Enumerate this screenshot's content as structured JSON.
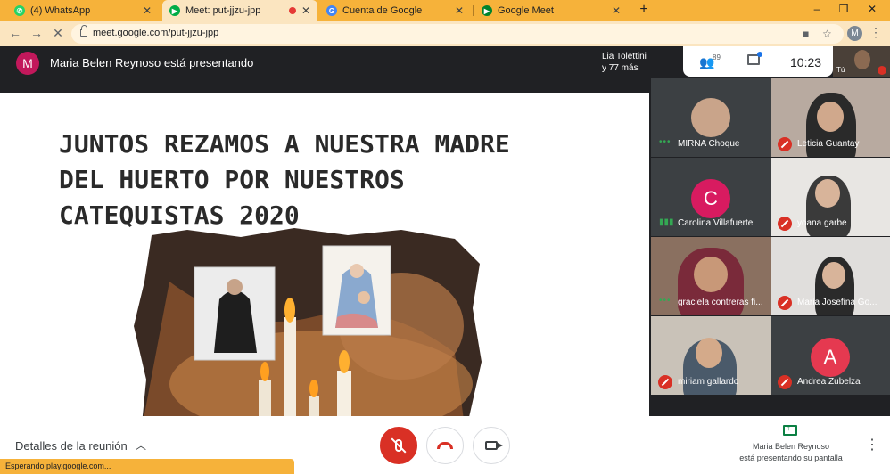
{
  "browser": {
    "tabs": [
      {
        "title": "(4) WhatsApp",
        "favicon": "whatsapp-icon",
        "color": "#25d366"
      },
      {
        "title": "Meet: put-jjzu-jpp",
        "favicon": "meet-icon",
        "color": "#00ac47",
        "active": true,
        "recording": true
      },
      {
        "title": "Cuenta de Google",
        "favicon": "google-icon",
        "color": "#4285f4"
      },
      {
        "title": "Google Meet",
        "favicon": "meet-icon",
        "color": "#00832d"
      }
    ],
    "url": "meet.google.com/put-jjzu-jpp",
    "profile_initial": "M",
    "status_text": "Esperando play.google.com..."
  },
  "meet_header": {
    "presenter_initial": "M",
    "presenter_text": "Maria Belen Reynoso está presentando",
    "pinned_line1": "Lia Tolettini",
    "pinned_line2": "y 77 más",
    "participants_count": "89",
    "time": "10:23",
    "self_label": "Tú"
  },
  "slide": {
    "title": "JUNTOS REZAMOS A NUESTRA MADRE DEL HUERTO POR NUESTROS CATEQUISTAS 2020"
  },
  "participants": [
    {
      "name": "MIRNA Choque",
      "status": "speaking-dots",
      "kind": "photo-avatar"
    },
    {
      "name": "Leticia Guantay",
      "status": "muted",
      "kind": "video"
    },
    {
      "name": "Carolina Villafuerte",
      "status": "speaking-wave",
      "kind": "letter",
      "initial": "C",
      "avatar_color": "#d81b60"
    },
    {
      "name": "yoana garbe",
      "status": "muted",
      "kind": "video"
    },
    {
      "name": "graciela contreras fi...",
      "status": "speaking-dots",
      "kind": "video"
    },
    {
      "name": "Maria Josefina Go...",
      "status": "muted",
      "kind": "video"
    },
    {
      "name": "miriam gallardo",
      "status": "muted",
      "kind": "video"
    },
    {
      "name": "Andrea Zubelza",
      "status": "muted",
      "kind": "letter",
      "initial": "A",
      "avatar_color": "#e53950"
    }
  ],
  "bottom_bar": {
    "details_label": "Detalles de la reunión",
    "present_line1": "Maria Belen Reynoso",
    "present_line2": "está presentando su pantalla"
  }
}
